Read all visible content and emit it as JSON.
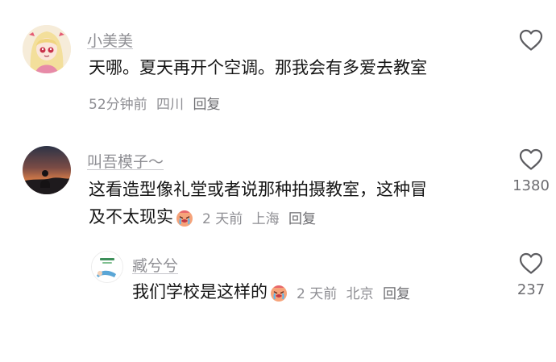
{
  "comments": [
    {
      "username": "小美美",
      "text": "天哪。夏天再开个空调。那我会有多爱去教室",
      "time": "52分钟前",
      "location": "四川",
      "reply_label": "回复",
      "like_count": ""
    },
    {
      "username": "叫吾模子～",
      "text_line1": "这看造型像礼堂或者说那种拍摄教室，这种冒",
      "text_line2": "及不太现实",
      "emoji": "crying-face-emoji",
      "time": "2 天前",
      "location": "上海",
      "reply_label": "回复",
      "like_count": "1380"
    },
    {
      "username": "臧兮兮",
      "text": "我们学校是这样的",
      "emoji": "crying-face-emoji",
      "time": "2 天前",
      "location": "北京",
      "reply_label": "回复",
      "like_count": "237"
    }
  ],
  "icons": {
    "like": "heart-outline-icon"
  }
}
